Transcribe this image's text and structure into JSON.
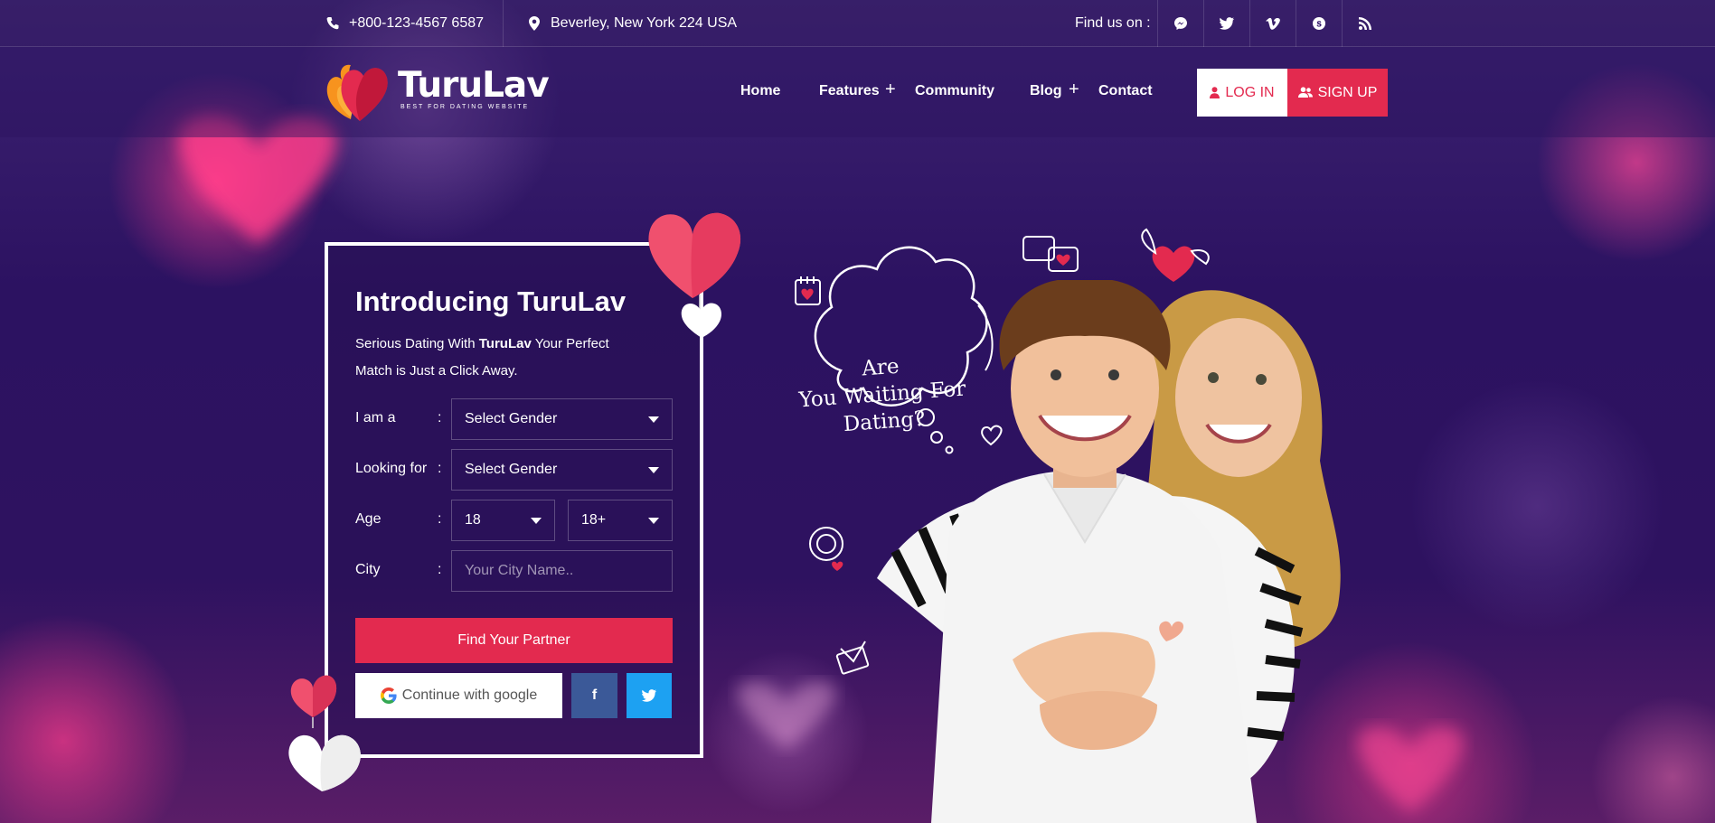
{
  "topbar": {
    "phone": "+800-123-4567 6587",
    "address": "Beverley, New York 224 USA",
    "find_us": "Find us on :",
    "socials": [
      "messenger-icon",
      "twitter-icon",
      "vimeo-icon",
      "skype-icon",
      "rss-icon"
    ]
  },
  "brand": {
    "name": "TuruLav",
    "tagline": "BEST FOR DATING WEBSITE"
  },
  "nav": {
    "home": "Home",
    "features": "Features",
    "community": "Community",
    "blog": "Blog",
    "contact": "Contact",
    "plus": "+"
  },
  "auth": {
    "login": "LOG IN",
    "signup": "SIGN UP"
  },
  "form": {
    "title": "Introducing TuruLav",
    "desc_before": "Serious Dating With ",
    "desc_brand": "TuruLav",
    "desc_after": " Your Perfect Match is Just a Click Away.",
    "colon": ":",
    "iam_label": "I am a",
    "iam_value": "Select Gender",
    "looking_label": "Looking for",
    "looking_value": "Select Gender",
    "age_label": "Age",
    "age_from": "18",
    "age_to": "18+",
    "city_label": "City",
    "city_placeholder": "Your City Name..",
    "find_button": "Find Your Partner",
    "google_button": "Continue with google",
    "facebook_button": "f"
  },
  "hero": {
    "thought_line1": "Are",
    "thought_line2": "You Waiting For",
    "thought_line3": "Dating?"
  },
  "colors": {
    "accent": "#e32a4f",
    "background": "#2c1261",
    "facebook": "#3b5998",
    "twitter": "#1da1f2"
  }
}
